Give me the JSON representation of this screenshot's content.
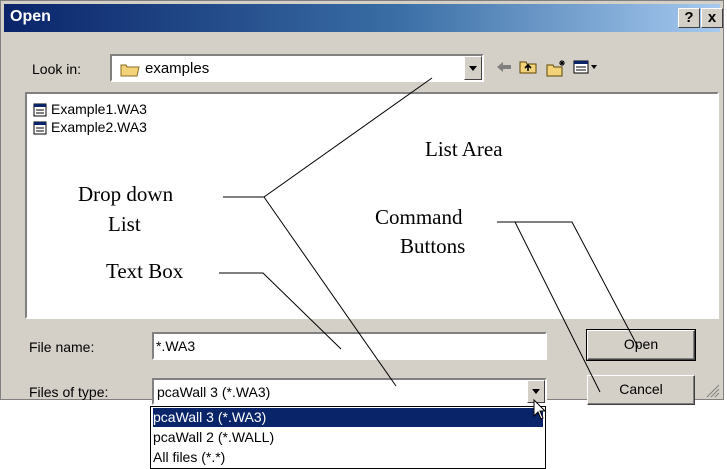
{
  "dialog": {
    "title": "Open",
    "help_button": "?",
    "close_button": "x"
  },
  "look_in": {
    "label": "Look in:",
    "value": "examples",
    "icons": [
      "folder-icon",
      "back-arrow-icon",
      "up-folder-icon",
      "new-folder-icon",
      "view-menu-icon"
    ]
  },
  "files": [
    {
      "name": "Example1.WA3"
    },
    {
      "name": "Example2.WA3"
    }
  ],
  "annotations": {
    "list_area": "List Area",
    "drop_down_1": "Drop down",
    "drop_down_2": "List",
    "command_1": "Command",
    "command_2": "Buttons",
    "text_box": "Text Box"
  },
  "file_name": {
    "label": "File name:",
    "value": "*.WA3"
  },
  "file_type": {
    "label": "Files of type:",
    "value": "pcaWall 3 (*.WA3)",
    "options": [
      "pcaWall 3 (*.WA3)",
      "pcaWall 2 (*.WALL)",
      "All files (*.*)"
    ],
    "selected_index": 0
  },
  "buttons": {
    "open": "Open",
    "cancel": "Cancel"
  },
  "colors": {
    "title_bar": "#0a246a",
    "dialog_face": "#d4d0c8",
    "selection": "#0a246a"
  }
}
